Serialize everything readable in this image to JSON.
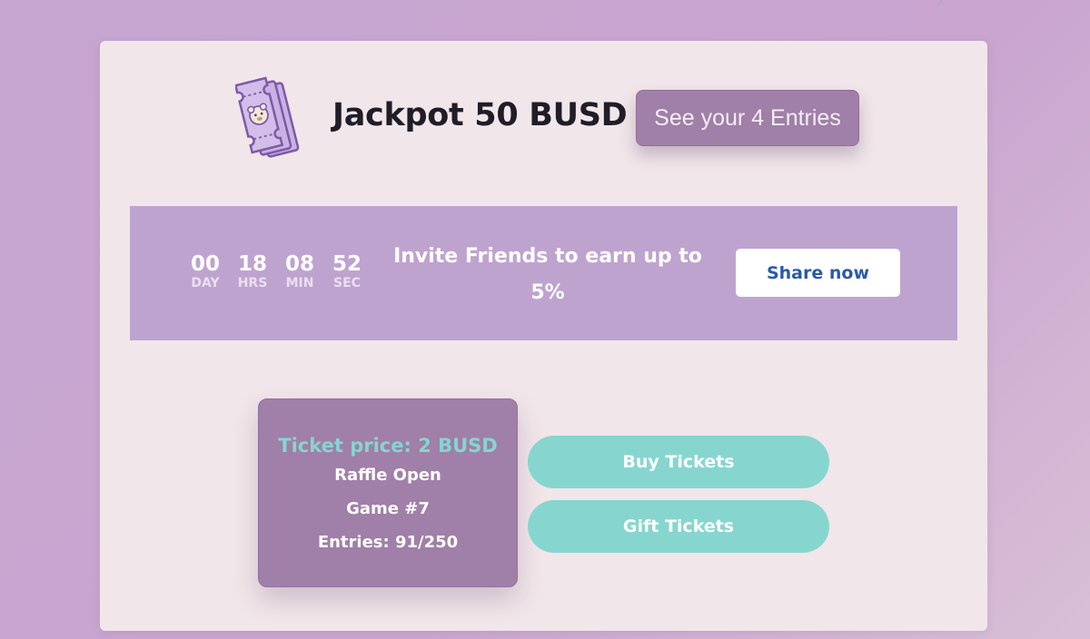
{
  "header": {
    "title": "Jackpot 50 BUSD",
    "entries_button": "See your 4 Entries",
    "icon": "raffle-tickets-icon"
  },
  "countdown": {
    "units": [
      {
        "value": "00",
        "label": "DAY"
      },
      {
        "value": "18",
        "label": "HRS"
      },
      {
        "value": "08",
        "label": "MIN"
      },
      {
        "value": "52",
        "label": "SEC"
      }
    ]
  },
  "invite": {
    "text": "Invite Friends to earn up to 5%",
    "share_button": "Share now"
  },
  "raffle": {
    "ticket_price": "Ticket price: 2 BUSD",
    "status": "Raffle Open",
    "game": "Game #7",
    "entries": "Entries: 91/250"
  },
  "actions": {
    "buy": "Buy Tickets",
    "gift": "Gift Tickets"
  },
  "colors": {
    "page_background": "#c9a5d0",
    "card_background": "#f1e6e9",
    "banner_background": "#bfa3cf",
    "purple_button": "#a07fa8",
    "teal_button": "#86d6cf",
    "share_text": "#2a5aa8"
  }
}
